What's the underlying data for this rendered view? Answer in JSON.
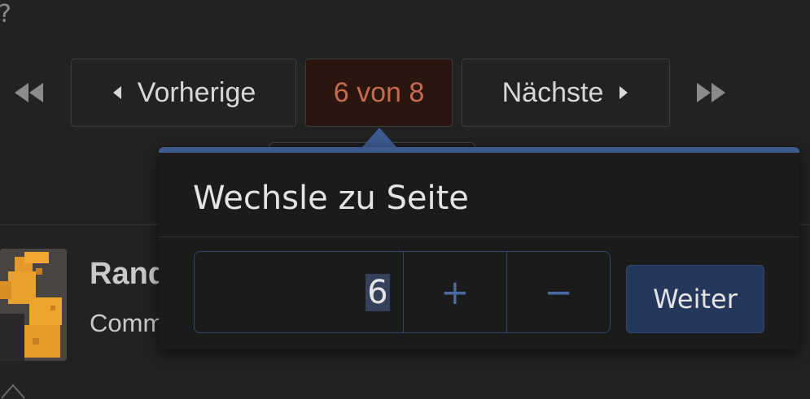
{
  "top_stub": "?",
  "pagination": {
    "prev_label": "Vorherige",
    "current_label": "6 von 8",
    "next_label": "Nächste",
    "current_page": 6,
    "total_pages": 8
  },
  "thread": {
    "title": "Rand",
    "meta": "Comm"
  },
  "goto_popup": {
    "title": "Wechsle zu Seite",
    "page_value": "6",
    "plus_label": "+",
    "minus_label": "−",
    "submit_label": "Weiter"
  },
  "colors": {
    "accent_blue": "#3d5a8f",
    "current_page_text": "#c46c4d",
    "current_page_bg": "#2b150f",
    "submit_bg": "#25375a"
  }
}
